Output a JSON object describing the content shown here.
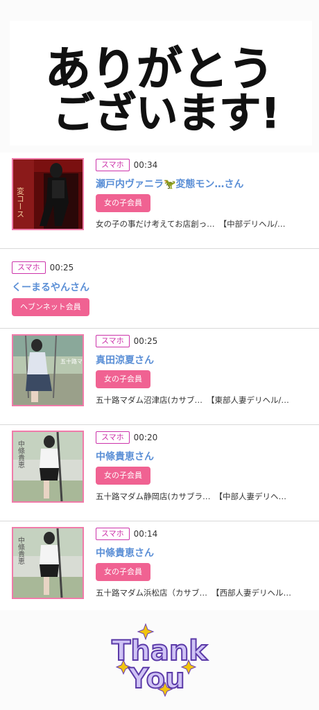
{
  "header": {
    "line1": "ありがとう",
    "line2": "ございます!"
  },
  "items": [
    {
      "device": "スマホ",
      "time": "00:34",
      "name": "瀬戸内ヴァニラ🦖変態モン…さん",
      "badge": "女の子会員",
      "shop": "女の子の事だけ考えてお店創っ…",
      "area": "【中部デリヘル/…",
      "thumb_text": "変コース"
    },
    {
      "device": "スマホ",
      "time": "00:25",
      "name": "くーまるやんさん",
      "badge": "ヘブンネット会員"
    },
    {
      "device": "スマホ",
      "time": "00:25",
      "name": "真田涼夏さん",
      "badge": "女の子会員",
      "shop": "五十路マダム沼津店(カサブ…",
      "area": "【東部人妻デリヘル/…",
      "thumb_text": "五十路マダム"
    },
    {
      "device": "スマホ",
      "time": "00:20",
      "name": "中條貴恵さん",
      "badge": "女の子会員",
      "shop": "五十路マダム静岡店(カサブラ…",
      "area": "【中部人妻デリヘ…",
      "thumb_text": "中條貴恵"
    },
    {
      "device": "スマホ",
      "time": "00:14",
      "name": "中條貴恵さん",
      "badge": "女の子会員",
      "shop": "五十路マダム浜松店（カサブ…",
      "area": "【西部人妻デリヘル…",
      "thumb_text": "中條貴恵"
    }
  ],
  "footer": {
    "line1": "Thank",
    "line2": "You"
  },
  "colors": {
    "accent_pink": "#f06292",
    "name_blue": "#5b8fd6",
    "tag_magenta": "#cc33aa",
    "thumb_border": "#f07ba9"
  }
}
